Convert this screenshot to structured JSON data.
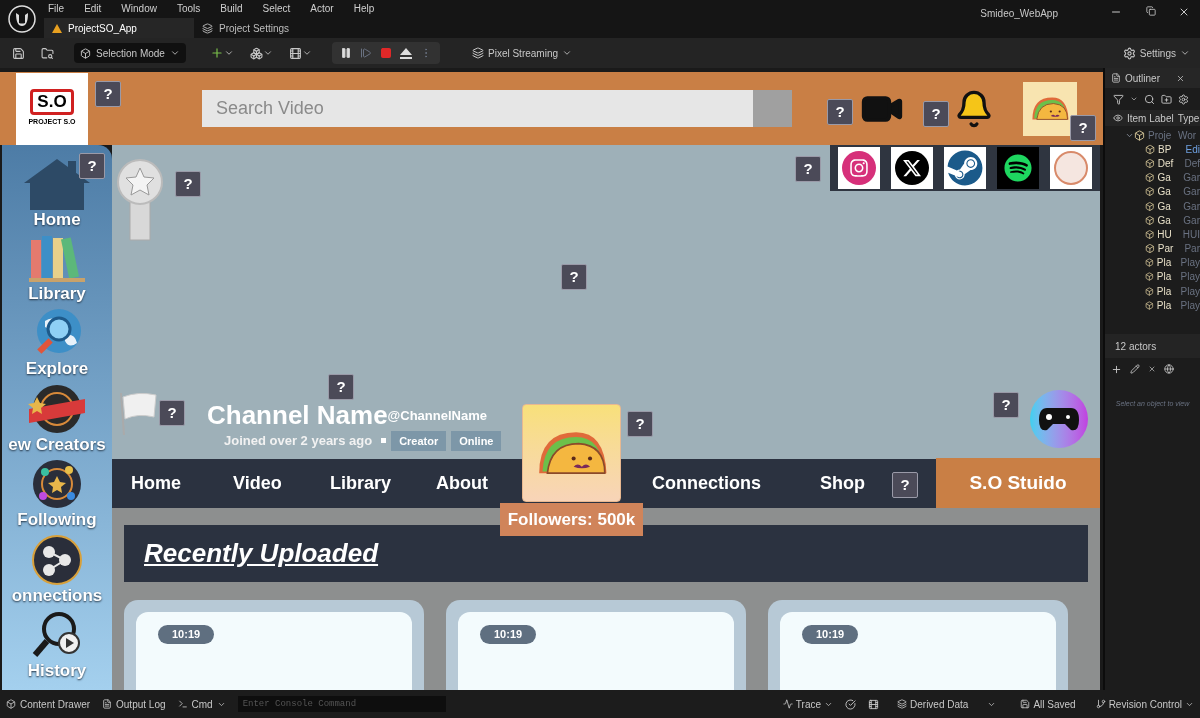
{
  "editor": {
    "menu": [
      "File",
      "Edit",
      "Window",
      "Tools",
      "Build",
      "Select",
      "Actor",
      "Help"
    ],
    "tabs": [
      {
        "label": "ProjectSO_App",
        "selected": true
      },
      {
        "label": "Project Settings",
        "selected": false
      }
    ],
    "title": "Smideo_WebApp",
    "toolbar": {
      "mode": "Selection Mode",
      "streaming": "Pixel Streaming",
      "settings": "Settings"
    }
  },
  "app": {
    "logo": {
      "mark": "S.O",
      "caption": "PROJECT S.O"
    },
    "search": {
      "placeholder": "Search Video"
    },
    "sidebar": {
      "items": [
        {
          "kind": "home",
          "label": "Home"
        },
        {
          "kind": "library",
          "label": "Library"
        },
        {
          "kind": "explore",
          "label": "Explore"
        },
        {
          "kind": "new",
          "label": "ew Creators"
        },
        {
          "kind": "following",
          "label": "Following"
        },
        {
          "kind": "connections",
          "label": "onnections"
        },
        {
          "kind": "history",
          "label": "History"
        }
      ]
    },
    "socials": [
      {
        "kind": "instagram"
      },
      {
        "kind": "x"
      },
      {
        "kind": "steam"
      },
      {
        "kind": "spotify"
      },
      {
        "kind": "badge"
      }
    ],
    "channel": {
      "name": "Channel Name",
      "handle": "@ChannelName",
      "joined": "Joined over 2 years ago",
      "badges": [
        "Creator",
        "Online"
      ],
      "followers": "Followers: 500k"
    },
    "nav": {
      "items": [
        "Home",
        "Video",
        "Library",
        "About",
        "Connections",
        "Shop"
      ],
      "cta": "S.O Stuido"
    },
    "section_title": "Recently Uploaded",
    "videos": [
      {
        "duration": "10:19"
      },
      {
        "duration": "10:19"
      },
      {
        "duration": "10:19"
      }
    ],
    "help_markers": [
      "?",
      "?",
      "?",
      "?",
      "?",
      "?",
      "?",
      "?",
      "?",
      "?",
      "?",
      "?",
      "?"
    ]
  },
  "outliner": {
    "title": "Outliner",
    "columns": [
      "Item Label",
      "Type"
    ],
    "tree": [
      {
        "label": "Proje",
        "type": "Wor",
        "children": [
          {
            "label": "BP",
            "type": "Edi"
          },
          {
            "label": "Def",
            "type": "Def"
          },
          {
            "label": "Ga",
            "type": "Gar"
          },
          {
            "label": "Ga",
            "type": "Gar"
          },
          {
            "label": "Ga",
            "type": "Gar"
          },
          {
            "label": "Ga",
            "type": "Gar"
          },
          {
            "label": "HU",
            "type": "HUI"
          },
          {
            "label": "Par",
            "type": "Par"
          },
          {
            "label": "Pla",
            "type": "Play"
          },
          {
            "label": "Pla",
            "type": "Play"
          },
          {
            "label": "Pla",
            "type": "Play"
          },
          {
            "label": "Pla",
            "type": "Play"
          }
        ]
      }
    ],
    "count": "12 actors",
    "details_hint": "Select an object to view"
  },
  "status_bar": {
    "left": [
      "Content Drawer",
      "Output Log",
      "Cmd"
    ],
    "console": {
      "placeholder": "Enter Console Command"
    },
    "trace": "Trace",
    "derived": "Derived Data",
    "saved": "All Saved",
    "revision": "Revision Control"
  }
}
